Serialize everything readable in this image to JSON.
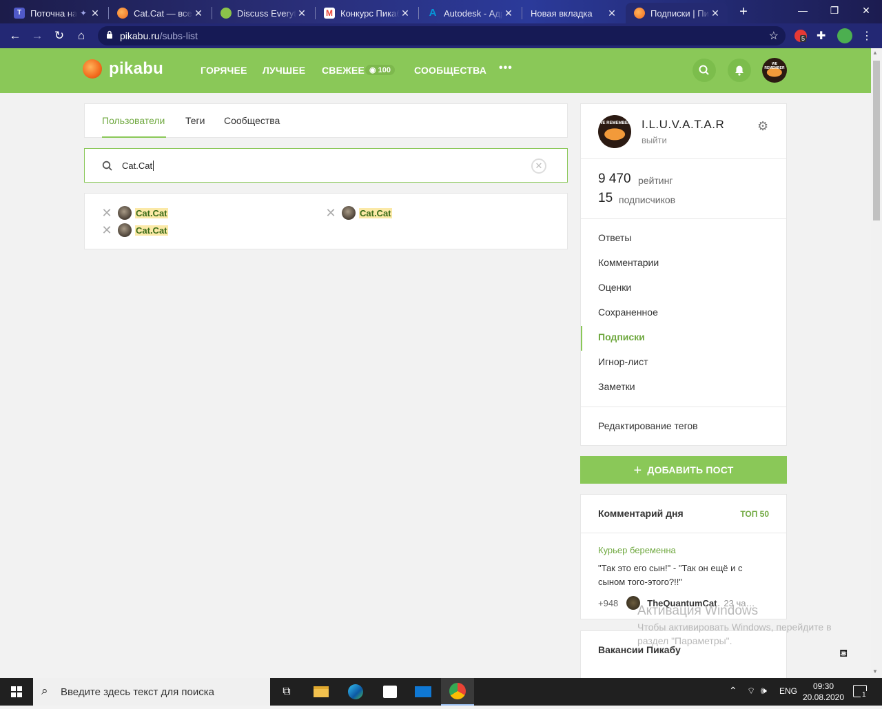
{
  "browser": {
    "tabs": [
      {
        "title": "Поточна на",
        "color": "#5059c9"
      },
      {
        "title": "Cat.Cat — все п",
        "color": "#f26b1d"
      },
      {
        "title": "Discuss Everythi",
        "color": "#8bc34a"
      },
      {
        "title": "Конкурс Пикаб",
        "color": "#ea4335"
      },
      {
        "title": "Autodesk - Адре",
        "color": "#0696d7"
      },
      {
        "title": "Новая вкладка",
        "color": ""
      },
      {
        "title": "Подписки | Пик",
        "color": "#f26b1d"
      }
    ],
    "url_host": "pikabu.ru",
    "url_path": "/subs-list",
    "extension_badge": "5"
  },
  "header": {
    "logo_text": "pikabu",
    "nav": [
      "ГОРЯЧЕЕ",
      "ЛУЧШЕЕ",
      "СВЕЖЕЕ",
      "СООБЩЕСТВА"
    ],
    "fresh_count": "100",
    "avatar_text": "WE REMEMBER"
  },
  "subs": {
    "tabs": [
      "Пользователи",
      "Теги",
      "Сообщества"
    ],
    "search_value": "Cat.Cat",
    "results": [
      "Cat.Cat",
      "Cat.Cat",
      "Cat.Cat"
    ]
  },
  "profile": {
    "avatar_text": "WE REMEMBER",
    "username": "I.L.U.V.A.T.A.R",
    "logout": "выйти",
    "rating_value": "9 470",
    "rating_label": "рейтинг",
    "subscribers_value": "15",
    "subscribers_label": "подписчиков",
    "menu": [
      "Ответы",
      "Комментарии",
      "Оценки",
      "Сохраненное",
      "Подписки",
      "Игнор-лист",
      "Заметки"
    ],
    "edit_tags": "Редактирование тегов"
  },
  "add_post": "ДОБАВИТЬ ПОСТ",
  "comment_of_day": {
    "title": "Комментарий дня",
    "top_link": "ТОП 50",
    "post_title": "Курьер беременна",
    "text": "\"Так это его сын!\" - \"Так он ещё и с сыном того-этого?!!\"",
    "score": "+948",
    "author": "TheQuantumCat",
    "time": "23 ча…"
  },
  "vacancies": {
    "title": "Вакансии Пикабу"
  },
  "watermark": {
    "title": "Активация Windows",
    "text": "Чтобы активировать Windows, перейдите в раздел \"Параметры\"."
  },
  "taskbar": {
    "search_placeholder": "Введите здесь текст для поиска",
    "lang": "ENG",
    "time": "09:30",
    "date": "20.08.2020",
    "notification_count": "1"
  },
  "colors": {
    "accent": "#8ac858",
    "accent_dark": "#6fa83f"
  }
}
